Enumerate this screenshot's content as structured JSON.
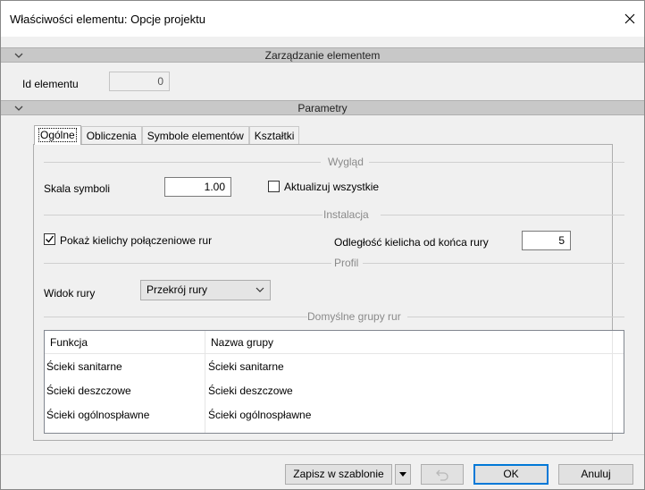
{
  "window": {
    "title": "Właściwości elementu: Opcje projektu"
  },
  "sections": {
    "management": {
      "title": "Zarządzanie elementem"
    },
    "parameters": {
      "title": "Parametry"
    }
  },
  "element_id": {
    "label": "Id elementu",
    "value": "0"
  },
  "tabs": [
    {
      "label": "Ogólne"
    },
    {
      "label": "Obliczenia"
    },
    {
      "label": "Symbole elementów"
    },
    {
      "label": "Kształtki"
    }
  ],
  "appearance": {
    "group_title": "Wygląd",
    "scale_label": "Skala symboli",
    "scale_value": "1.00",
    "update_all_label": "Aktualizuj wszystkie",
    "update_all_checked": false
  },
  "installation": {
    "group_title": "Instalacja",
    "show_sockets_label": "Pokaż kielichy połączeniowe rur",
    "show_sockets_checked": true,
    "socket_distance_label": "Odległość kielicha od końca rury",
    "socket_distance_value": "5"
  },
  "profile": {
    "group_title": "Profil",
    "pipe_view_label": "Widok rury",
    "pipe_view_value": "Przekrój rury"
  },
  "default_groups": {
    "group_title": "Domyślne grupy rur",
    "columns": [
      "Funkcja",
      "Nazwa grupy"
    ],
    "rows": [
      [
        "Ścieki sanitarne",
        "Ścieki sanitarne"
      ],
      [
        "Ścieki deszczowe",
        "Ścieki deszczowe"
      ],
      [
        "Ścieki ogólnospławne",
        "Ścieki ogólnospławne"
      ]
    ]
  },
  "buttons": {
    "save_template": "Zapisz w szablonie",
    "ok": "OK",
    "cancel": "Anuluj"
  },
  "colors": {
    "accent": "#0078d7",
    "section_header": "#c8c8c8"
  }
}
